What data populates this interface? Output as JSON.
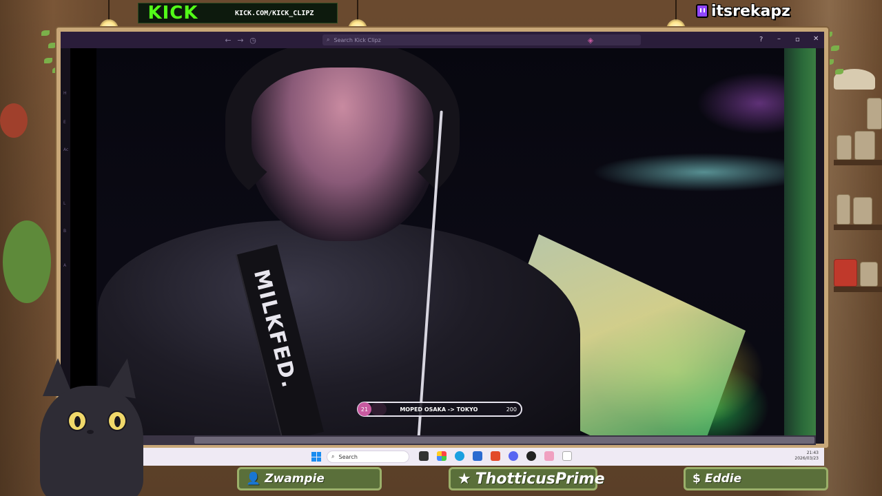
{
  "stream": {
    "platform_logo": "KICK",
    "clip_url": "KICK.COM/KICK_CLIPZ",
    "channel": "itsrekapz",
    "channel_icon": "twitch-icon"
  },
  "browser": {
    "search_placeholder": "Search Kick Clipz",
    "rail_letters": [
      "H",
      "E",
      "Ac",
      "L",
      "B",
      "A"
    ]
  },
  "video": {
    "strap_text": "MILKFED.",
    "trip": {
      "start": "21",
      "label": "MOPED OSAKA -> TOKYO",
      "end": "200",
      "progress_fraction": 0.105
    }
  },
  "taskbar": {
    "search_placeholder": "Search",
    "time": "21:43",
    "date": "2026/03/23"
  },
  "viewers": [
    {
      "name": "Zwampie",
      "icon": "person-icon"
    },
    {
      "name": "ThotticusPrime",
      "icon": "star-icon"
    },
    {
      "name": "Eddie",
      "icon": "dollar-icon"
    }
  ],
  "colors": {
    "kick_green": "#53fc18",
    "frame": "#c8a778",
    "plate": "#5a6f3a",
    "trip_accent": "#c85aa0"
  }
}
